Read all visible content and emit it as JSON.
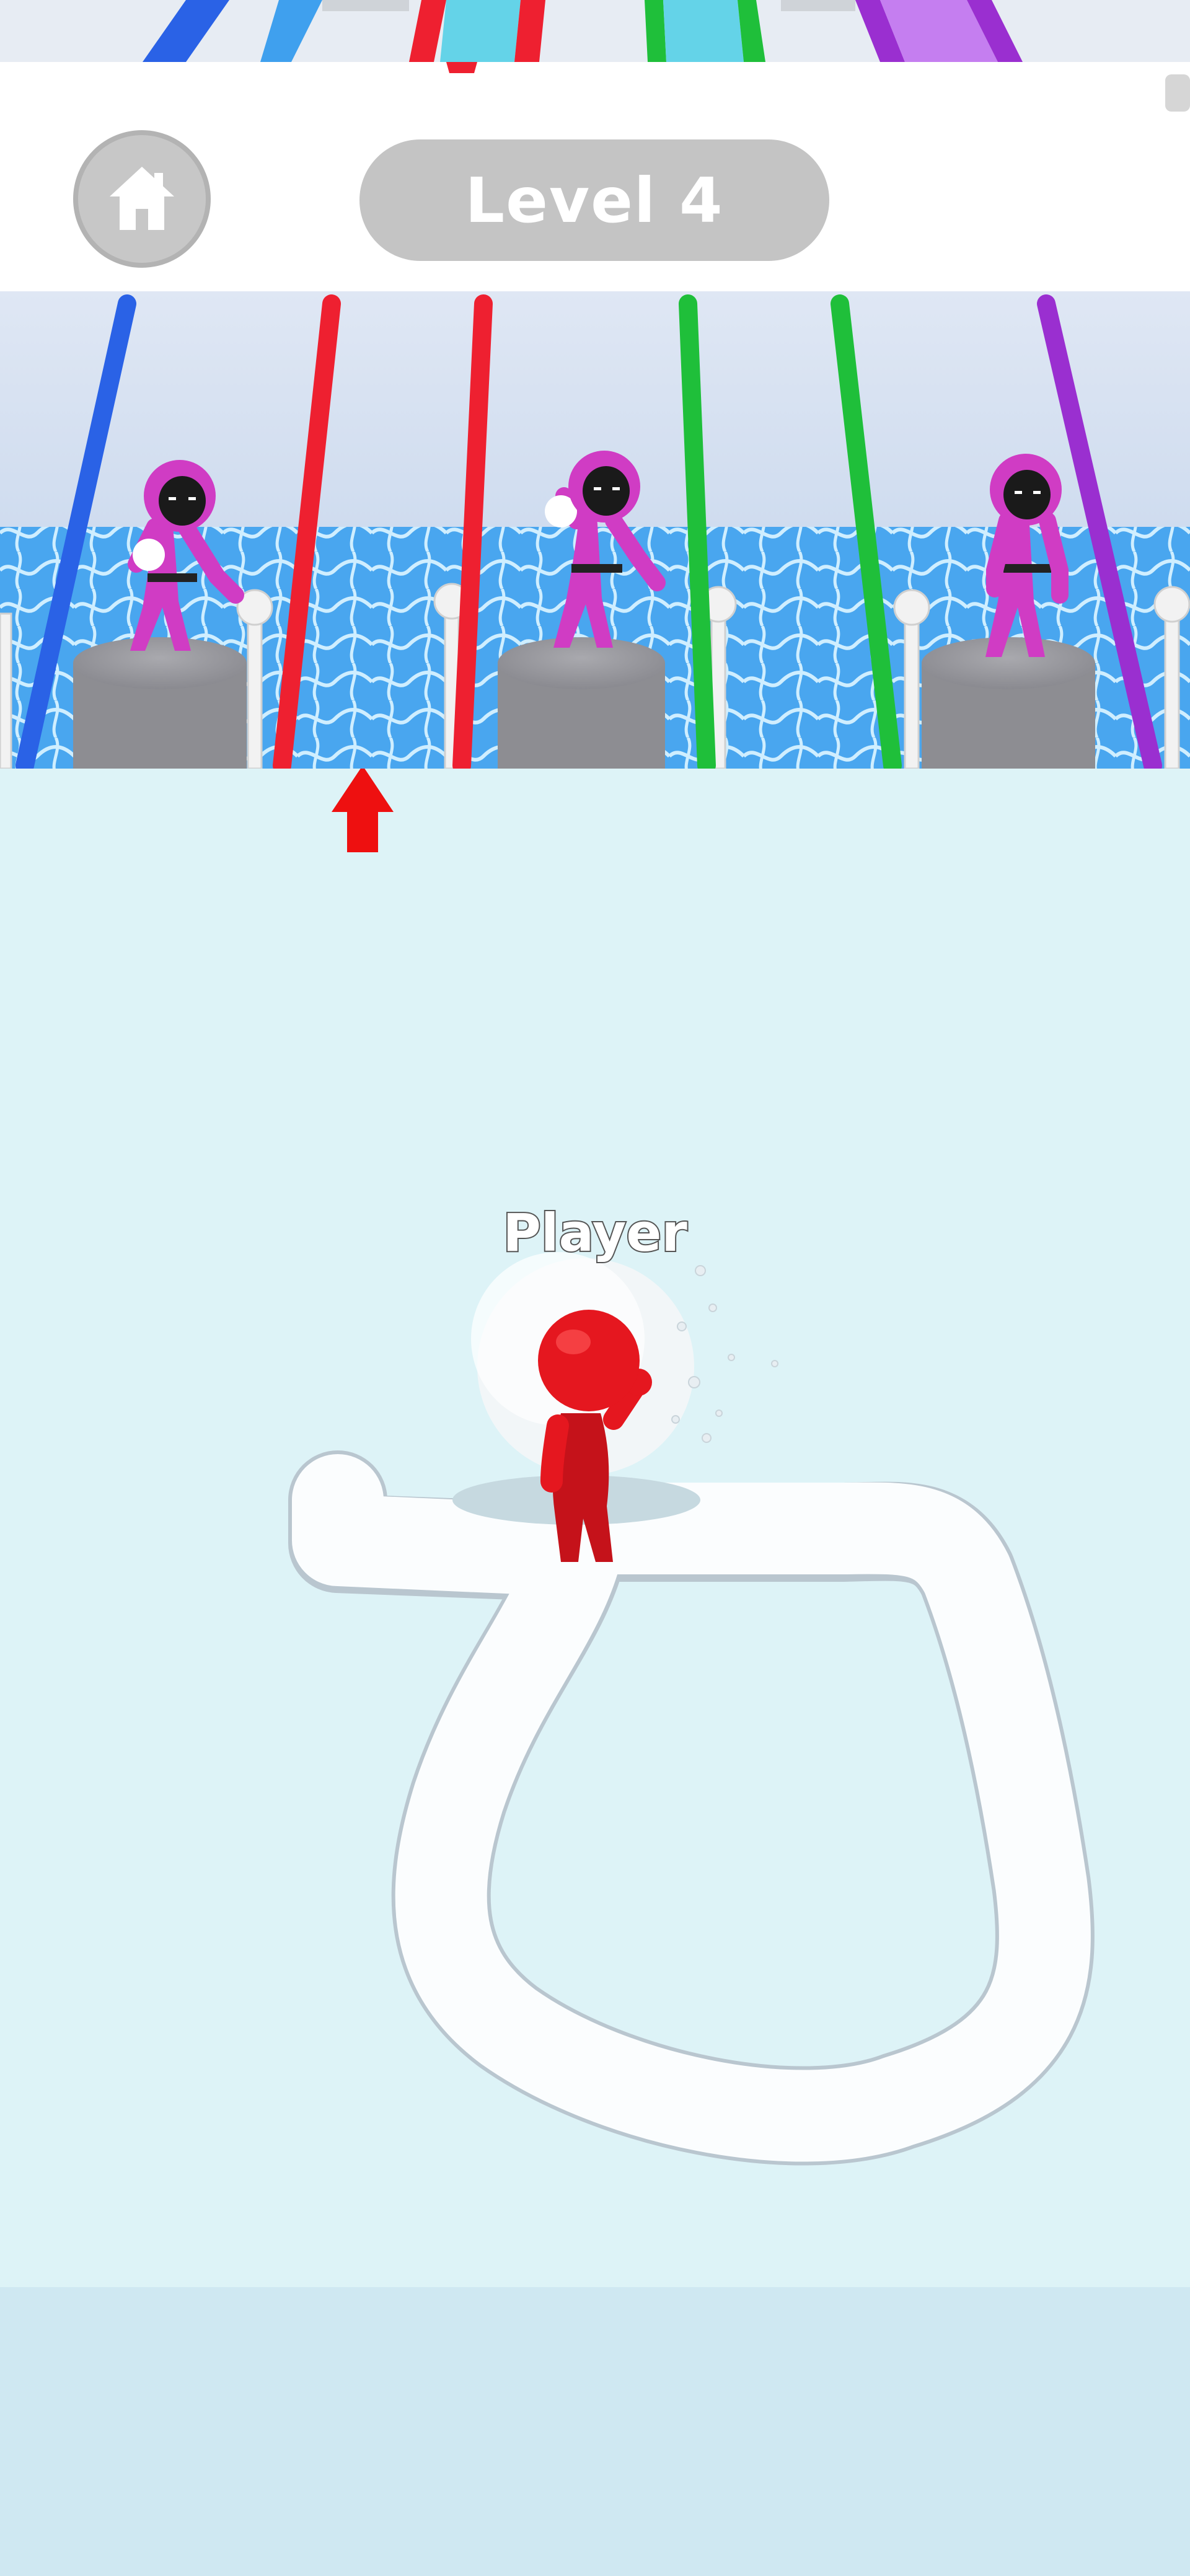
{
  "hud": {
    "home_icon": "home-icon",
    "level_label": "Level 4"
  },
  "player": {
    "name_label": "Player"
  },
  "colors": {
    "pole_blue": "#2a62e6",
    "pole_red": "#ee2030",
    "pole_green": "#1fbf3a",
    "pole_purple": "#9a2fd0",
    "guard_pink": "#d03cc4",
    "player_red": "#e5171f",
    "water": "#49a6ef",
    "field": "#ddf3f7"
  }
}
